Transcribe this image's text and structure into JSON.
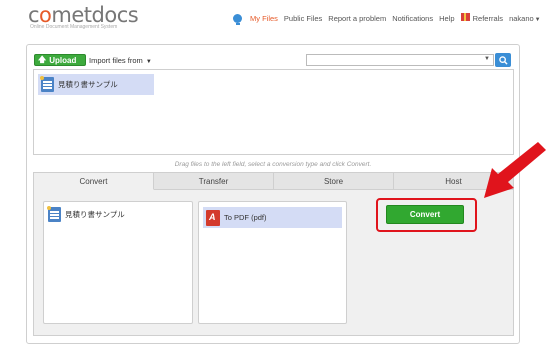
{
  "brand": {
    "name_prefix": "c",
    "name_o": "o",
    "name_suffix": "metdocs",
    "tagline": "Online Document Management System"
  },
  "topnav": {
    "items": [
      "My Files",
      "Public Files",
      "Report a problem",
      "Notifications",
      "Help",
      "Referrals",
      "nakano"
    ],
    "active": "My Files"
  },
  "toolbar": {
    "upload_label": "Upload",
    "import_label": "Import files from"
  },
  "search": {
    "placeholder": ""
  },
  "files": [
    {
      "name": "見積り書サンプル",
      "icon": "document-icon",
      "selected": true
    }
  ],
  "hint": "Drag files to the left field, select a conversion type and click Convert.",
  "tabs": [
    {
      "label": "Convert",
      "active": true
    },
    {
      "label": "Transfer",
      "active": false
    },
    {
      "label": "Store",
      "active": false
    },
    {
      "label": "Host",
      "active": false
    }
  ],
  "convert_panel": {
    "source_file": "見積り書サンプル",
    "format_label": "To PDF (pdf)",
    "format_icon": "pdf-icon",
    "button_label": "Convert"
  },
  "colors": {
    "accent_orange": "#e65b2a",
    "green_button": "#31a830",
    "highlight_red": "#e0141c",
    "selection_blue": "#d4dcf5"
  }
}
